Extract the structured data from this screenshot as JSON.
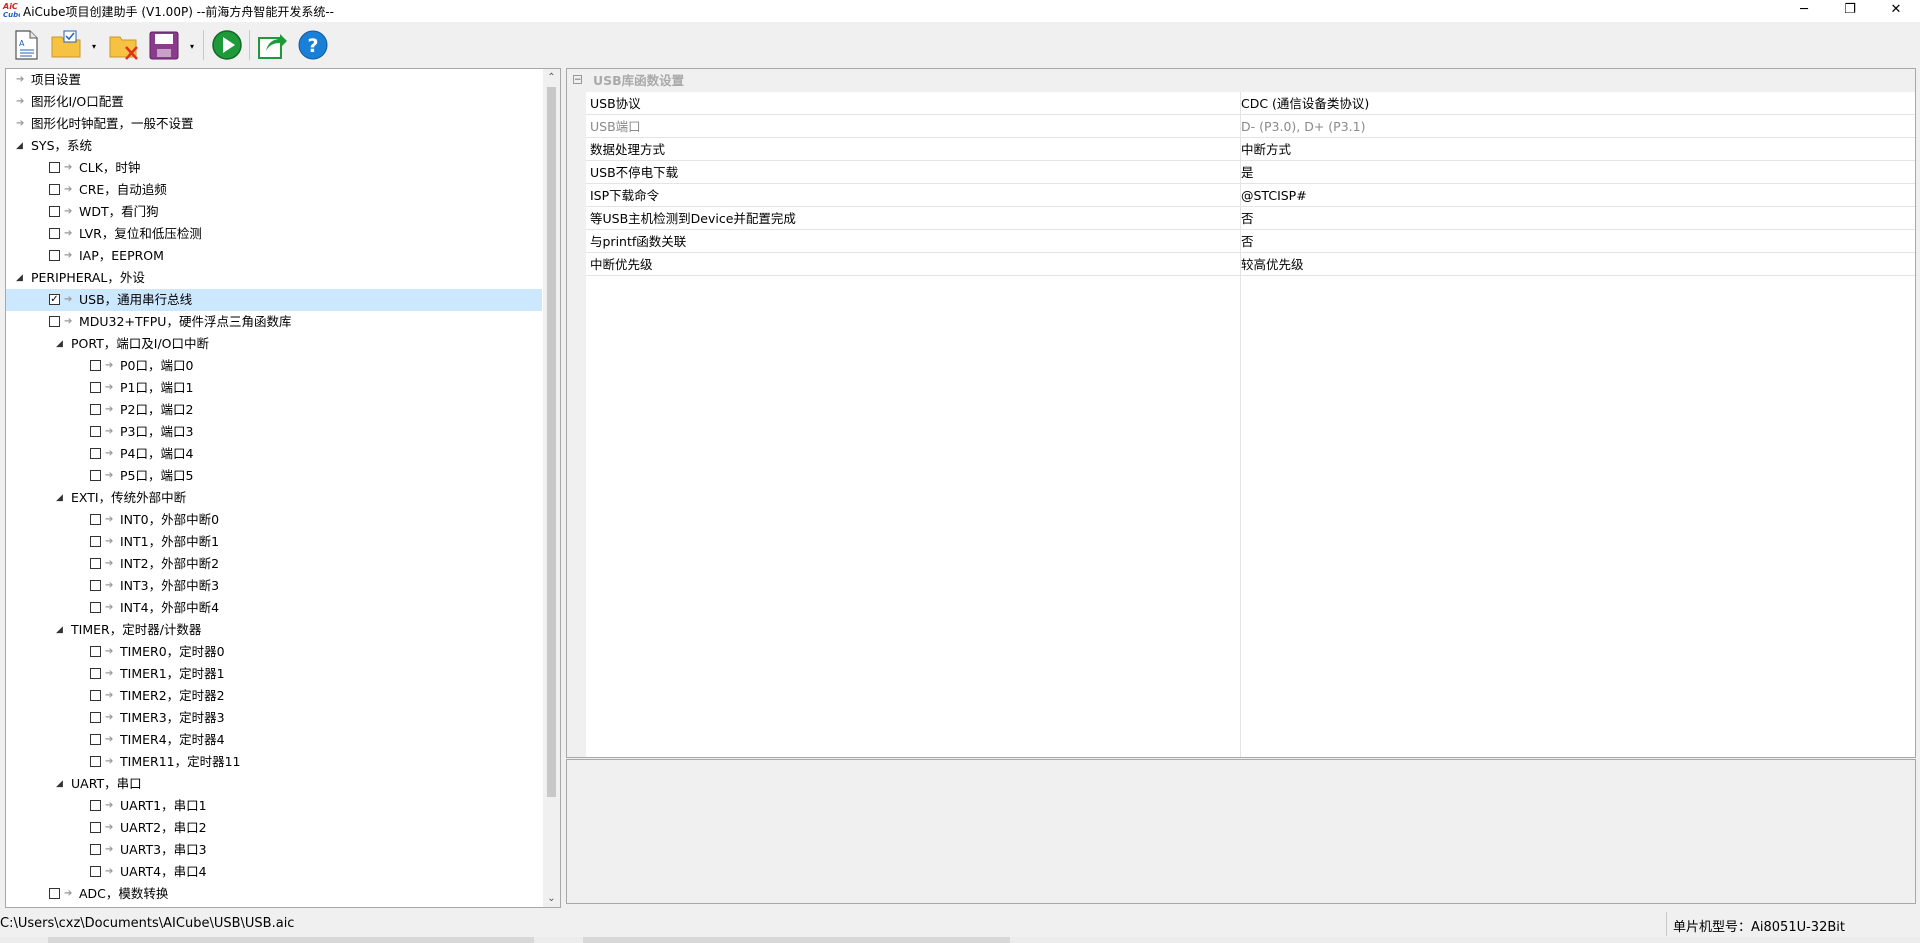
{
  "window": {
    "title": "AiCube项目创建助手 (V1.00P) --前海方舟智能开发系统--",
    "logo_text": "AiC\nCube"
  },
  "window_controls": {
    "minimize": "─",
    "restore": "❐",
    "close": "✕"
  },
  "toolbar": {
    "buttons": [
      {
        "icon": "new-document-icon"
      },
      {
        "icon": "open-project-icon"
      },
      {
        "icon": "close-project-icon"
      },
      {
        "icon": "save-icon"
      },
      {
        "icon": "run-icon"
      },
      {
        "icon": "export-icon"
      },
      {
        "icon": "help-icon"
      }
    ],
    "dropdown_glyph": "▾"
  },
  "tree": {
    "items": [
      {
        "label": "项目设置",
        "level": 0,
        "toggle": "",
        "checkbox": false,
        "checked": false
      },
      {
        "label": "图形化I/O口配置",
        "level": 0,
        "toggle": "",
        "checkbox": false,
        "checked": false
      },
      {
        "label": "图形化时钟配置，一般不设置",
        "level": 0,
        "toggle": "",
        "checkbox": false,
        "checked": false
      },
      {
        "label": "SYS，系统",
        "level": 0,
        "toggle": "◢",
        "checkbox": false,
        "checked": false
      },
      {
        "label": "CLK，时钟",
        "level": 1,
        "toggle": "",
        "checkbox": true,
        "checked": false
      },
      {
        "label": "CRE，自动追频",
        "level": 1,
        "toggle": "",
        "checkbox": true,
        "checked": false
      },
      {
        "label": "WDT，看门狗",
        "level": 1,
        "toggle": "",
        "checkbox": true,
        "checked": false
      },
      {
        "label": "LVR，复位和低压检测",
        "level": 1,
        "toggle": "",
        "checkbox": true,
        "checked": false
      },
      {
        "label": "IAP，EEPROM",
        "level": 1,
        "toggle": "",
        "checkbox": true,
        "checked": false
      },
      {
        "label": "PERIPHERAL，外设",
        "level": 0,
        "toggle": "◢",
        "checkbox": false,
        "checked": false
      },
      {
        "label": "USB，通用串行总线",
        "level": 1,
        "toggle": "",
        "checkbox": true,
        "checked": true,
        "selected": true
      },
      {
        "label": "MDU32+TFPU，硬件浮点三角函数库",
        "level": 1,
        "toggle": "",
        "checkbox": true,
        "checked": false
      },
      {
        "label": "PORT，端口及I/O口中断",
        "level": 1,
        "toggle": "◢",
        "checkbox": false,
        "checked": false
      },
      {
        "label": "P0口，端口0",
        "level": 2,
        "toggle": "",
        "checkbox": true,
        "checked": false
      },
      {
        "label": "P1口，端口1",
        "level": 2,
        "toggle": "",
        "checkbox": true,
        "checked": false
      },
      {
        "label": "P2口，端口2",
        "level": 2,
        "toggle": "",
        "checkbox": true,
        "checked": false
      },
      {
        "label": "P3口，端口3",
        "level": 2,
        "toggle": "",
        "checkbox": true,
        "checked": false
      },
      {
        "label": "P4口，端口4",
        "level": 2,
        "toggle": "",
        "checkbox": true,
        "checked": false
      },
      {
        "label": "P5口，端口5",
        "level": 2,
        "toggle": "",
        "checkbox": true,
        "checked": false
      },
      {
        "label": "EXTI，传统外部中断",
        "level": 1,
        "toggle": "◢",
        "checkbox": false,
        "checked": false
      },
      {
        "label": "INT0，外部中断0",
        "level": 2,
        "toggle": "",
        "checkbox": true,
        "checked": false
      },
      {
        "label": "INT1，外部中断1",
        "level": 2,
        "toggle": "",
        "checkbox": true,
        "checked": false
      },
      {
        "label": "INT2，外部中断2",
        "level": 2,
        "toggle": "",
        "checkbox": true,
        "checked": false
      },
      {
        "label": "INT3，外部中断3",
        "level": 2,
        "toggle": "",
        "checkbox": true,
        "checked": false
      },
      {
        "label": "INT4，外部中断4",
        "level": 2,
        "toggle": "",
        "checkbox": true,
        "checked": false
      },
      {
        "label": "TIMER，定时器/计数器",
        "level": 1,
        "toggle": "◢",
        "checkbox": false,
        "checked": false
      },
      {
        "label": "TIMER0，定时器0",
        "level": 2,
        "toggle": "",
        "checkbox": true,
        "checked": false
      },
      {
        "label": "TIMER1，定时器1",
        "level": 2,
        "toggle": "",
        "checkbox": true,
        "checked": false
      },
      {
        "label": "TIMER2，定时器2",
        "level": 2,
        "toggle": "",
        "checkbox": true,
        "checked": false
      },
      {
        "label": "TIMER3，定时器3",
        "level": 2,
        "toggle": "",
        "checkbox": true,
        "checked": false
      },
      {
        "label": "TIMER4，定时器4",
        "level": 2,
        "toggle": "",
        "checkbox": true,
        "checked": false
      },
      {
        "label": "TIMER11，定时器11",
        "level": 2,
        "toggle": "",
        "checkbox": true,
        "checked": false
      },
      {
        "label": "UART，串口",
        "level": 1,
        "toggle": "◢",
        "checkbox": false,
        "checked": false
      },
      {
        "label": "UART1，串口1",
        "level": 2,
        "toggle": "",
        "checkbox": true,
        "checked": false
      },
      {
        "label": "UART2，串口2",
        "level": 2,
        "toggle": "",
        "checkbox": true,
        "checked": false
      },
      {
        "label": "UART3，串口3",
        "level": 2,
        "toggle": "",
        "checkbox": true,
        "checked": false
      },
      {
        "label": "UART4，串口4",
        "level": 2,
        "toggle": "",
        "checkbox": true,
        "checked": false
      },
      {
        "label": "ADC，模数转换",
        "level": 1,
        "toggle": "",
        "checkbox": true,
        "checked": false
      }
    ],
    "scroll_up": "⌃",
    "scroll_down": "⌄"
  },
  "properties": {
    "collapse_glyph": "−",
    "category": "USB库函数设置",
    "rows": [
      {
        "name": "USB协议",
        "value": "CDC (通信设备类协议)",
        "disabled": false
      },
      {
        "name": "USB端口",
        "value": "D- (P3.0), D+ (P3.1)",
        "disabled": true
      },
      {
        "name": "数据处理方式",
        "value": "中断方式",
        "disabled": false
      },
      {
        "name": "USB不停电下载",
        "value": "是",
        "disabled": false
      },
      {
        "name": "ISP下载命令",
        "value": "@STCISP#",
        "disabled": false
      },
      {
        "name": "等USB主机检测到Device并配置完成",
        "value": "否",
        "disabled": false
      },
      {
        "name": "与printf函数关联",
        "value": "否",
        "disabled": false
      },
      {
        "name": "中断优先级",
        "value": "较高优先级",
        "disabled": false
      }
    ]
  },
  "statusbar": {
    "path": "C:\\Users\\cxz\\Documents\\AICube\\USB\\USB.aic",
    "model": "单片机型号：Ai8051U-32Bit"
  }
}
